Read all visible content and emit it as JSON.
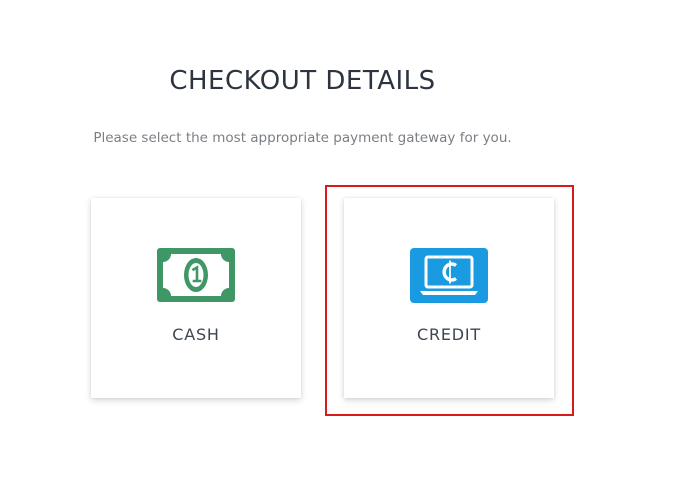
{
  "page": {
    "title": "CHECKOUT DETAILS",
    "subtitle": "Please select the most appropriate payment gateway for you."
  },
  "options": [
    {
      "label": "CASH",
      "icon": "cash-bill-icon",
      "icon_color": "#3f9765",
      "selected": false
    },
    {
      "label": "CREDIT",
      "icon": "laptop-coin-icon",
      "icon_color": "#1a9ae0",
      "selected": true
    }
  ],
  "colors": {
    "selection_outline": "#d91a1a",
    "title_text": "#2b3440",
    "subtitle_text": "#7a7f85"
  }
}
